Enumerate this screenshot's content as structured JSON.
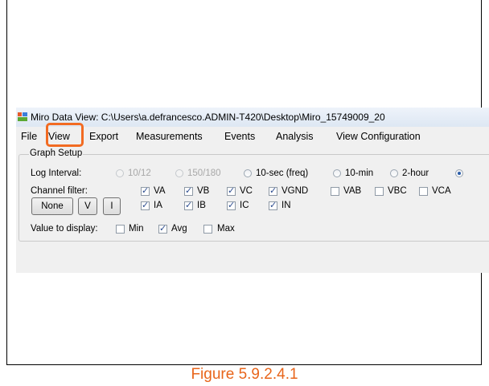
{
  "window": {
    "title": "Miro Data View: C:\\Users\\a.defrancesco.ADMIN-T420\\Desktop\\Miro_15749009_20"
  },
  "menu": {
    "items": [
      "File",
      "View",
      "Export",
      "Measurements",
      "Events",
      "Analysis",
      "View Configuration"
    ],
    "highlighted": "View",
    "highlight_color": "#f26b22"
  },
  "graph_setup": {
    "title": "Graph Setup",
    "log_interval": {
      "label": "Log Interval:",
      "options": [
        "10/12",
        "150/180",
        "10-sec (freq)",
        "10-min",
        "2-hour"
      ]
    },
    "channel_filter": {
      "label": "Channel filter:",
      "row1": [
        "VA",
        "VB",
        "VC",
        "VGND",
        "VAB",
        "VBC",
        "VCA"
      ],
      "row2": [
        "IA",
        "IB",
        "IC",
        "IN"
      ]
    },
    "buttons": {
      "none": "None",
      "v": "V",
      "i": "I"
    },
    "value_to_display": {
      "label": "Value to display:",
      "options": [
        "Min",
        "Avg",
        "Max"
      ]
    }
  },
  "caption": "Figure 5.9.2.4.1",
  "colors": {
    "caption": "#e8651b",
    "checkmark": "#2c4c8f"
  },
  "icons": {
    "app": "app-window-icon"
  }
}
